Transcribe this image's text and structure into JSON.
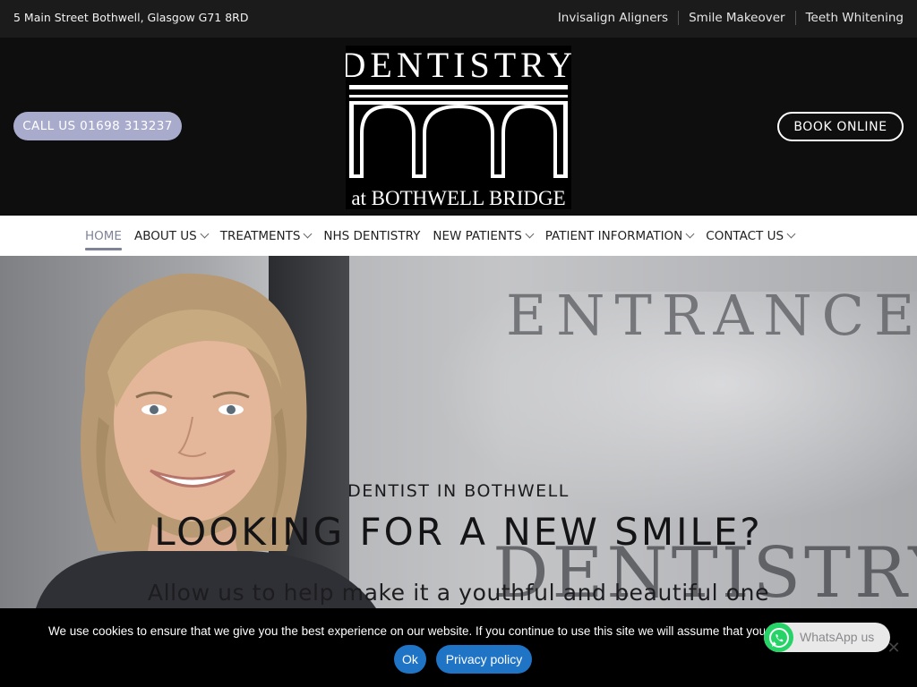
{
  "topbar": {
    "address": "5 Main Street Bothwell, Glasgow G71 8RD",
    "links": [
      "Invisalign Aligners",
      "Smile Makeover",
      "Teeth Whitening"
    ]
  },
  "header": {
    "call_label": "CALL US 01698 313237",
    "book_label": "BOOK ONLINE",
    "logo": {
      "line1": "DENTISTRY",
      "line2": "at BOTHWELL BRIDGE"
    }
  },
  "nav": {
    "items": [
      {
        "label": "HOME",
        "active": true,
        "dropdown": false
      },
      {
        "label": "ABOUT US",
        "active": false,
        "dropdown": true
      },
      {
        "label": "TREATMENTS",
        "active": false,
        "dropdown": true
      },
      {
        "label": "NHS DENTISTRY",
        "active": false,
        "dropdown": false
      },
      {
        "label": "NEW PATIENTS",
        "active": false,
        "dropdown": true
      },
      {
        "label": "PATIENT INFORMATION",
        "active": false,
        "dropdown": true
      },
      {
        "label": "CONTACT US",
        "active": false,
        "dropdown": true
      }
    ]
  },
  "hero": {
    "subtitle": "DENTIST IN BOTHWELL",
    "title": "LOOKING FOR A NEW SMILE?",
    "text": "Allow us to help make it a youthful and beautiful one",
    "bg_sign_top": "ENTRANCE",
    "bg_sign_bottom": "DENTISTRY"
  },
  "cookie": {
    "text": "We use cookies to ensure that we give you the best experience on our website. If you continue to use this site we will assume that you",
    "ok_label": "Ok",
    "privacy_label": "Privacy policy",
    "close_icon": "close-icon"
  },
  "whatsapp": {
    "label": "WhatsApp us",
    "icon": "whatsapp-icon"
  },
  "colors": {
    "call_button": "#a9abcd",
    "nav_active": "#7f8396",
    "cookie_button": "#1f74c6",
    "whatsapp_green": "#25d366"
  }
}
